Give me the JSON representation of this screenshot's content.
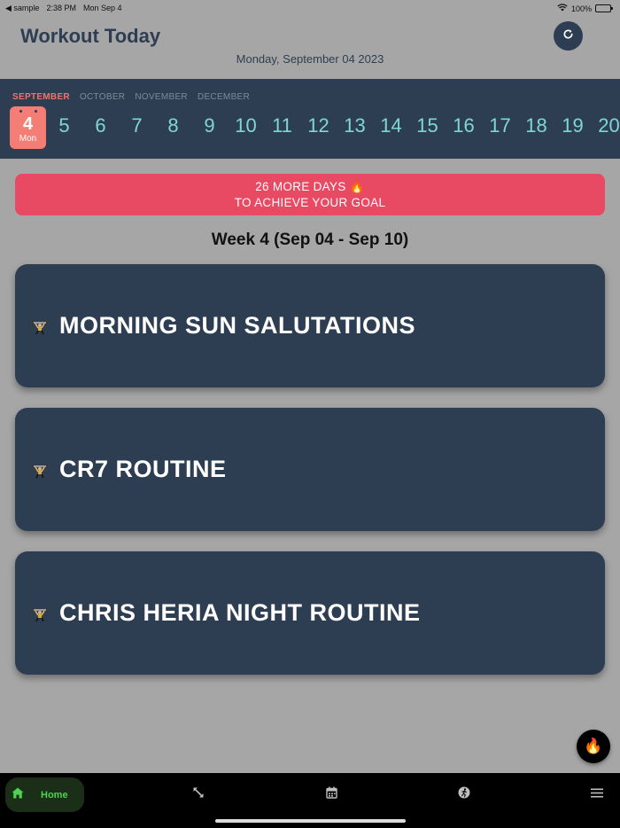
{
  "status_bar": {
    "back_app": "◀ sample",
    "time": "2:38 PM",
    "date": "Mon Sep 4",
    "battery": "100%",
    "battery_level": 1.0
  },
  "header": {
    "title": "Workout Today",
    "date": "Monday, September 04 2023",
    "refresh_icon": "refresh-icon"
  },
  "calendar": {
    "months": [
      "SEPTEMBER",
      "OCTOBER",
      "NOVEMBER",
      "DECEMBER"
    ],
    "active_month": "SEPTEMBER",
    "selected_day": {
      "number": "4",
      "weekday": "Mon"
    },
    "days": [
      "5",
      "6",
      "7",
      "8",
      "9",
      "10",
      "11",
      "12",
      "13",
      "14",
      "15",
      "16",
      "17",
      "18",
      "19",
      "20"
    ]
  },
  "goal_banner": {
    "line1": "26 MORE DAYS 🔥",
    "line2": "TO ACHIEVE YOUR GOAL"
  },
  "week_title": "Week 4 (Sep 04 - Sep 10)",
  "workouts": [
    {
      "name": "MORNING SUN SALUTATIONS",
      "icon": "weightlifter-icon"
    },
    {
      "name": "CR7 ROUTINE",
      "icon": "weightlifter-icon"
    },
    {
      "name": "CHRIS HERIA NIGHT ROUTINE",
      "icon": "weightlifter-icon"
    }
  ],
  "fab": {
    "icon": "fire-icon",
    "glyph": "🔥"
  },
  "bottom_nav": {
    "home_label": "Home",
    "items": [
      "home-icon",
      "expand-icon",
      "calendar-icon",
      "runner-icon",
      "menu-icon"
    ]
  },
  "colors": {
    "background": "#a6a6a6",
    "navy": "#2e3e52",
    "accent_red": "#e84a64",
    "selected_day": "#f47e76",
    "day_teal": "#7fd6d6",
    "nav_green": "#4cd450"
  }
}
